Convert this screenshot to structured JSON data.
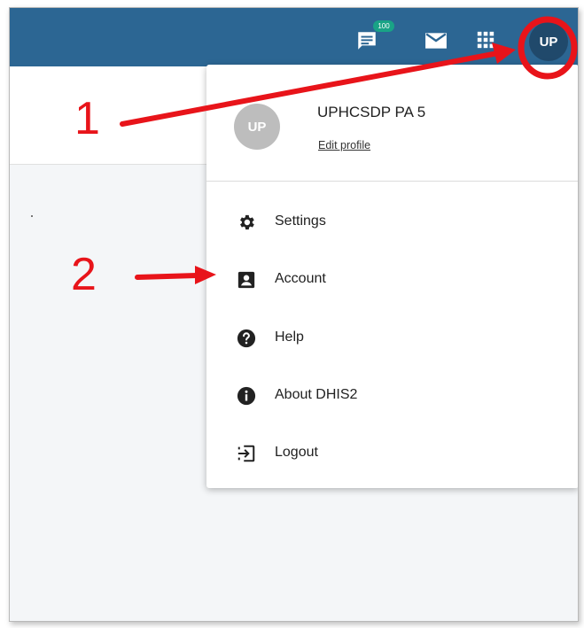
{
  "topbar": {
    "interpretations_badge": "100",
    "avatar_initials": "UP",
    "icons": [
      "interpretations-icon",
      "mail-icon",
      "apps-grid-icon"
    ]
  },
  "profile_menu": {
    "avatar_initials": "UP",
    "username": "UPHCSDP PA 5",
    "edit_profile": "Edit profile",
    "items": [
      {
        "label": "Settings",
        "icon": "gear-icon"
      },
      {
        "label": "Account",
        "icon": "account-box-icon"
      },
      {
        "label": "Help",
        "icon": "help-circle-icon"
      },
      {
        "label": "About DHIS2",
        "icon": "info-circle-icon"
      },
      {
        "label": "Logout",
        "icon": "logout-icon"
      }
    ]
  },
  "annotations": {
    "step1": "1",
    "step2": "2",
    "color": "#e8141a"
  },
  "colors": {
    "header": "#2c6693",
    "avatar_top": "#20496b",
    "avatar_menu": "#bdbdbd",
    "badge": "#19a386"
  }
}
